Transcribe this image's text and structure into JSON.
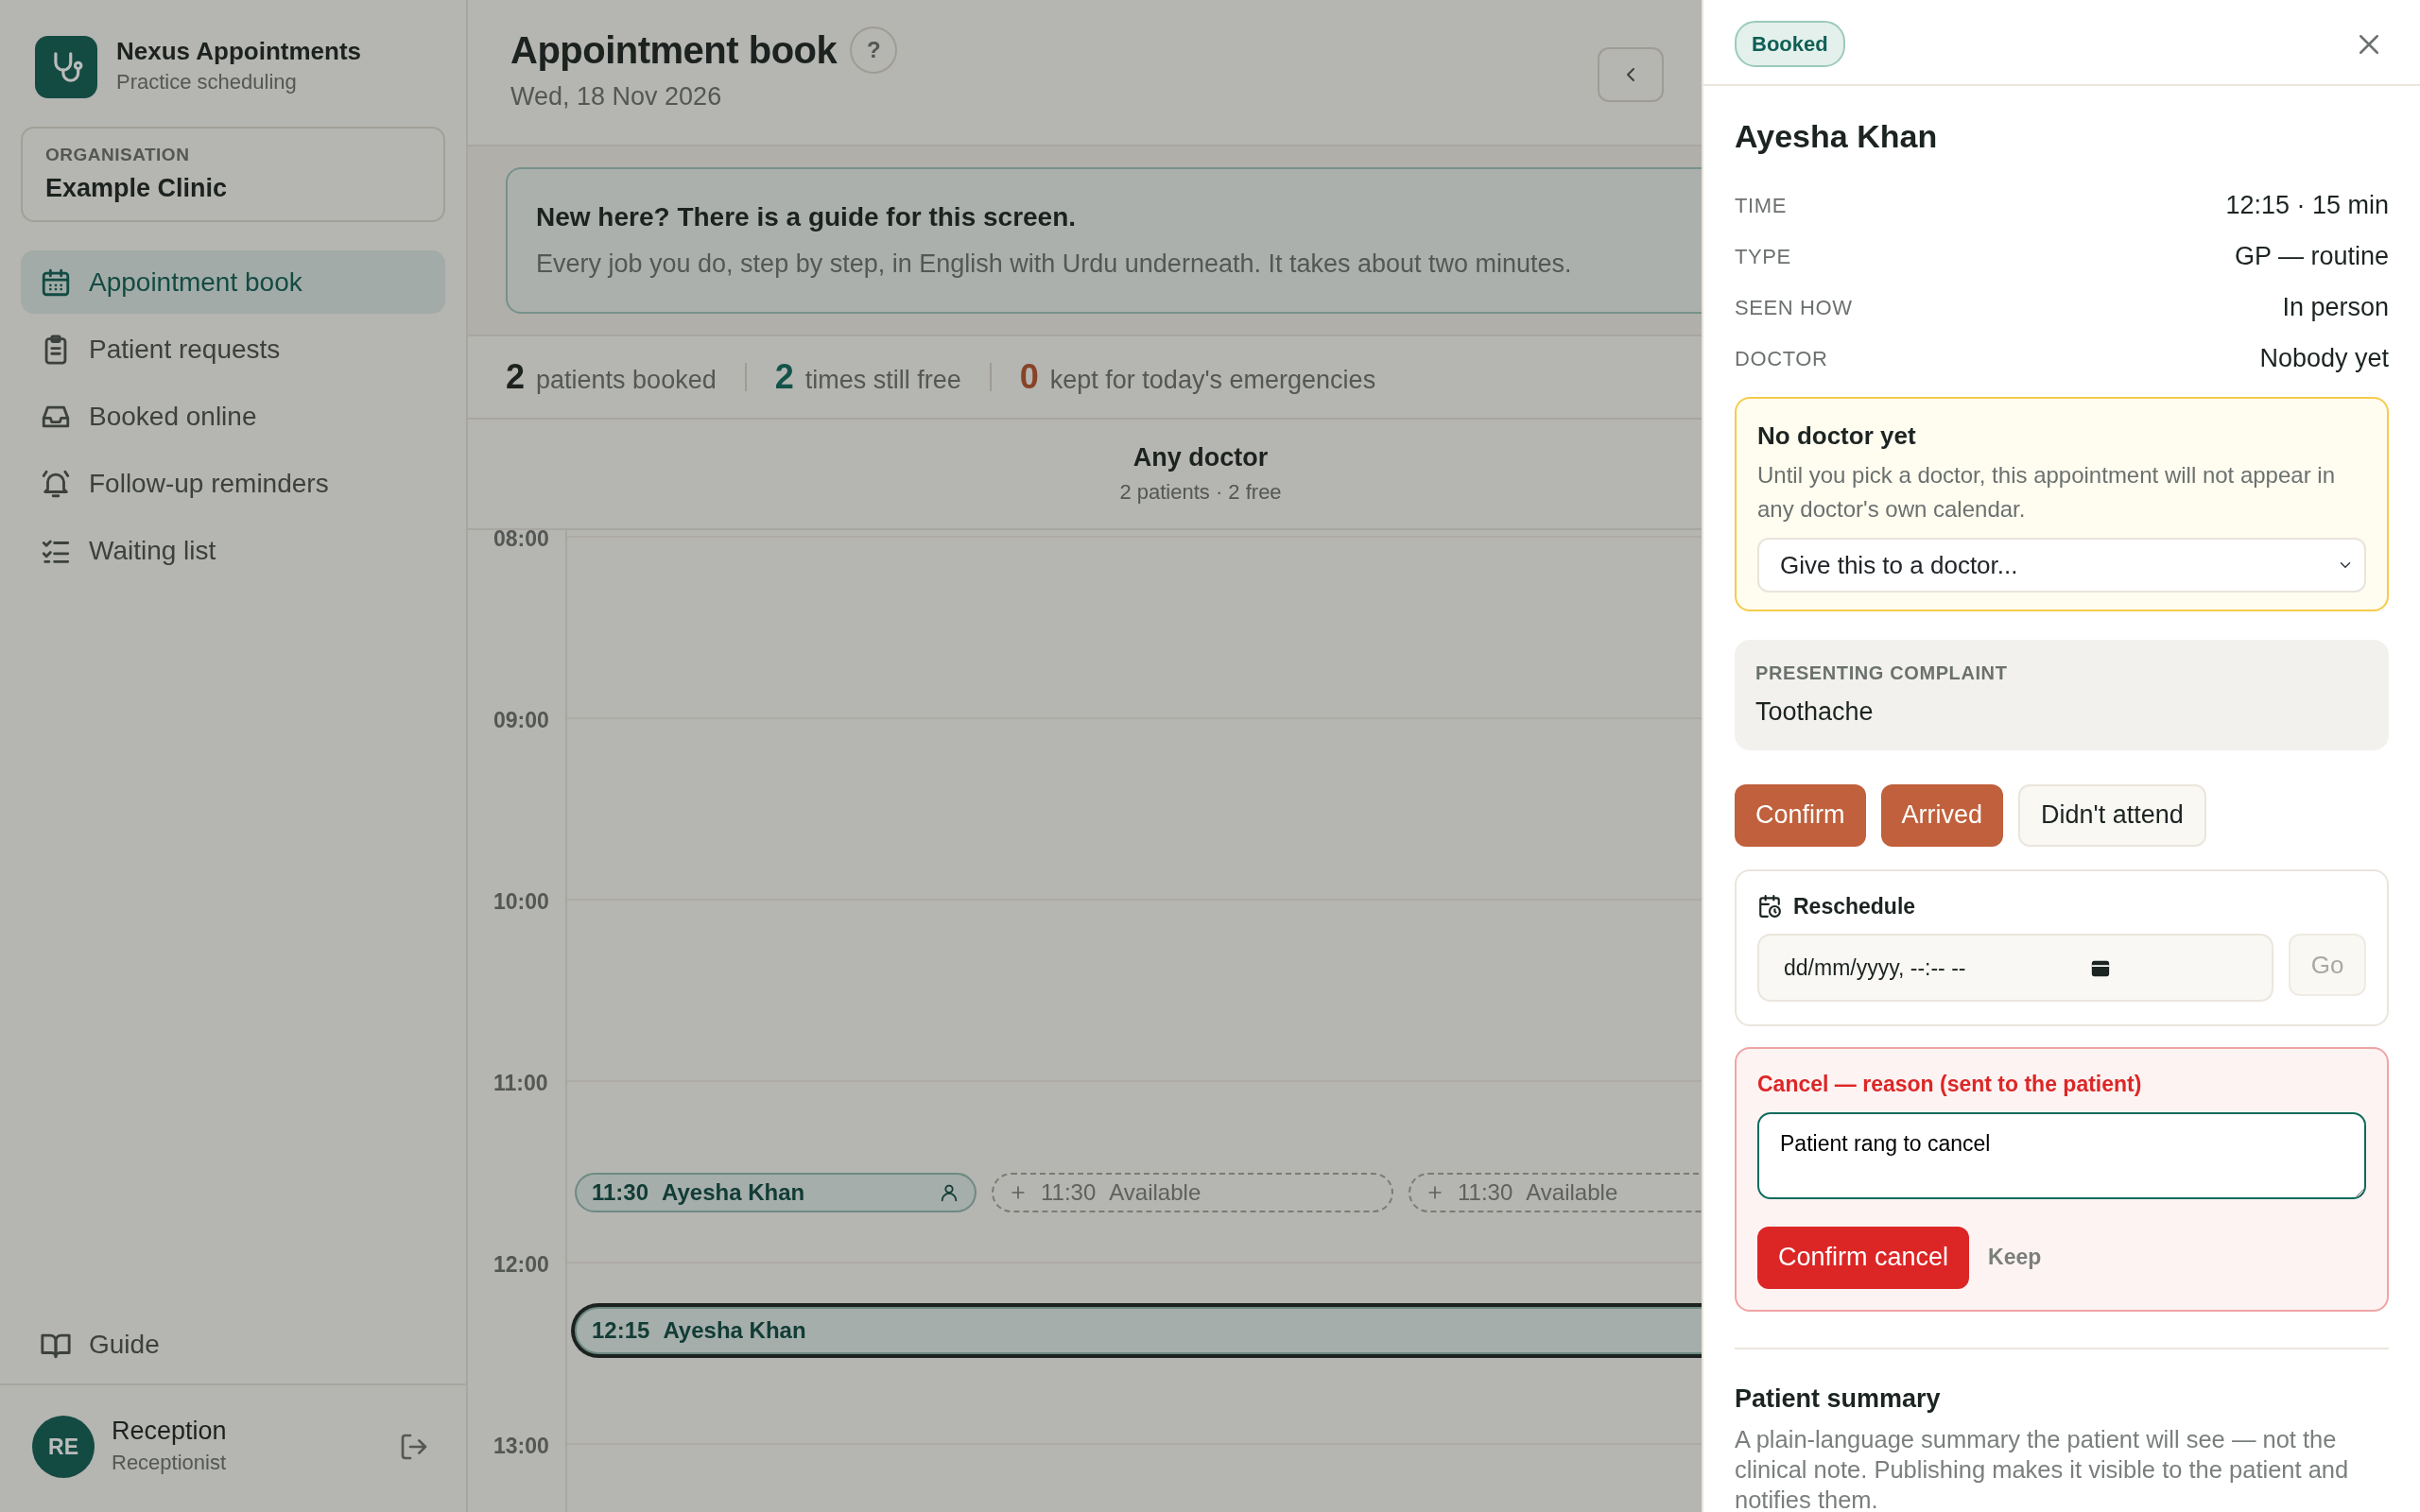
{
  "app": {
    "name": "Nexus Appointments",
    "subtitle": "Practice scheduling"
  },
  "organisation": {
    "label": "ORGANISATION",
    "name": "Example Clinic"
  },
  "nav": [
    {
      "label": "Appointment book",
      "selected": true
    },
    {
      "label": "Patient requests",
      "selected": false
    },
    {
      "label": "Booked online",
      "selected": false
    },
    {
      "label": "Follow-up reminders",
      "selected": false
    },
    {
      "label": "Waiting list",
      "selected": false
    }
  ],
  "guide_link": {
    "label": "Guide"
  },
  "user": {
    "initials": "RE",
    "name": "Reception",
    "role": "Receptionist"
  },
  "header": {
    "title": "Appointment book",
    "help": "?",
    "date": "Wed, 18 Nov 2026"
  },
  "banner": {
    "title": "New here? There is a guide for this screen.",
    "text": "Every job you do, step by step, in English with Urdu underneath. It takes about two minutes."
  },
  "stats": [
    {
      "value": "2",
      "label": "patients booked",
      "kind": "booked"
    },
    {
      "value": "2",
      "label": "times still free",
      "kind": "free"
    },
    {
      "value": "0",
      "label": "kept for today's emergencies",
      "kind": "emergency"
    }
  ],
  "calendar": {
    "column": {
      "title": "Any doctor",
      "subtitle": "2 patients · 2 free"
    },
    "hours": [
      {
        "label": "08:00"
      },
      {
        "label": "09:00"
      },
      {
        "label": "10:00"
      },
      {
        "label": "11:00",
        "items": [
          {
            "kind": "booked",
            "time": "11:30",
            "text": "Ayesha Khan",
            "selected": false
          },
          {
            "kind": "available",
            "time": "11:30",
            "text": "Available",
            "selected": false
          },
          {
            "kind": "available",
            "time": "11:30",
            "text": "Available",
            "selected": false
          }
        ]
      },
      {
        "label": "12:00",
        "items": [
          {
            "kind": "booked",
            "time": "12:15",
            "text": "Ayesha Khan",
            "selected": true
          }
        ]
      },
      {
        "label": "13:00"
      }
    ]
  },
  "drawer": {
    "status": "Booked",
    "patient": "Ayesha Khan",
    "details": [
      {
        "label": "TIME",
        "value": "12:15 · 15 min"
      },
      {
        "label": "TYPE",
        "value": "GP — routine"
      },
      {
        "label": "SEEN HOW",
        "value": "In person"
      },
      {
        "label": "DOCTOR",
        "value": "Nobody yet"
      }
    ],
    "notice": {
      "title": "No doctor yet",
      "text": "Until you pick a doctor, this appointment will not appear in any doctor's own calendar.",
      "select": "Give this to a doctor..."
    },
    "complaint": {
      "label": "PRESENTING COMPLAINT",
      "text": "Toothache"
    },
    "actions": [
      {
        "label": "Confirm",
        "kind": "primary"
      },
      {
        "label": "Arrived",
        "kind": "primary"
      },
      {
        "label": "Didn't attend",
        "kind": "outline"
      }
    ],
    "reschedule": {
      "title": "Reschedule",
      "placeholder": "dd/mm/yyyy, --:-- --",
      "button": "Go",
      "disabled": true
    },
    "cancel": {
      "label": "Cancel — reason (sent to the patient)",
      "value": "Patient rang to cancel",
      "confirm": "Confirm cancel",
      "keep": "Keep"
    },
    "summary": {
      "title": "Patient summary",
      "text": "A plain-language summary the patient will see — not the clinical note. Publishing makes it visible to the patient and notifies them."
    }
  }
}
